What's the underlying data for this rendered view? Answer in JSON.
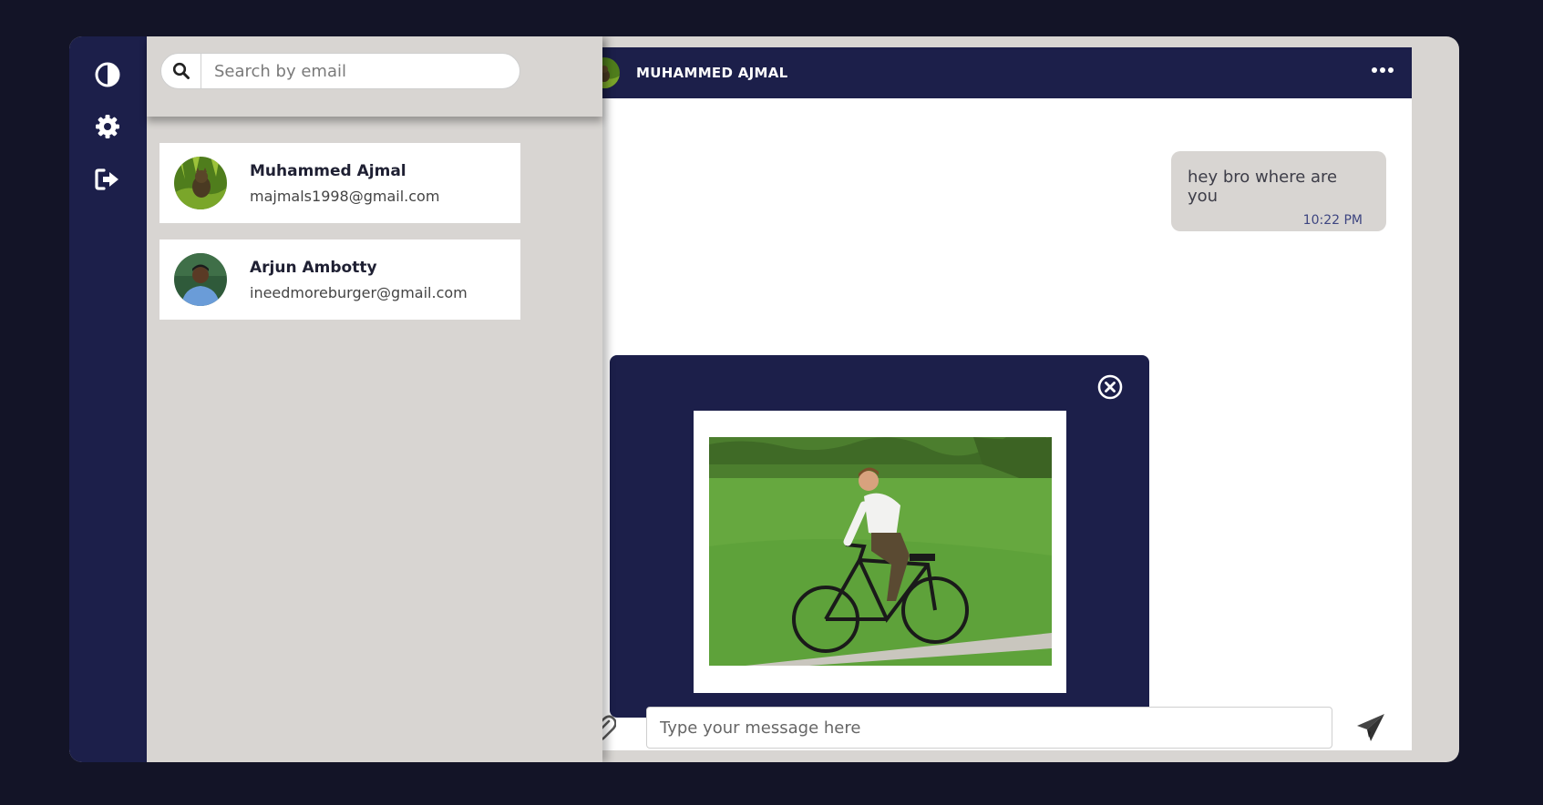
{
  "rail": {
    "icons": [
      "theme-toggle-icon",
      "settings-gear-icon",
      "logout-icon"
    ]
  },
  "search": {
    "placeholder": "Search by email",
    "value": ""
  },
  "contacts": [
    {
      "name": "Muhammed Ajmal",
      "email": "majmals1998@gmail.com"
    },
    {
      "name": "Arjun Ambotty",
      "email": "ineedmoreburger@gmail.com"
    }
  ],
  "chat": {
    "title": "MUHAMMED AJMAL",
    "messages": [
      {
        "text": "hey bro where are you",
        "time": "10:22 PM"
      }
    ],
    "composer": {
      "placeholder": "Type your message here",
      "value": ""
    }
  },
  "colors": {
    "navy": "#1c1f4a",
    "panel": "#d8d5d2",
    "background": "#131427"
  }
}
